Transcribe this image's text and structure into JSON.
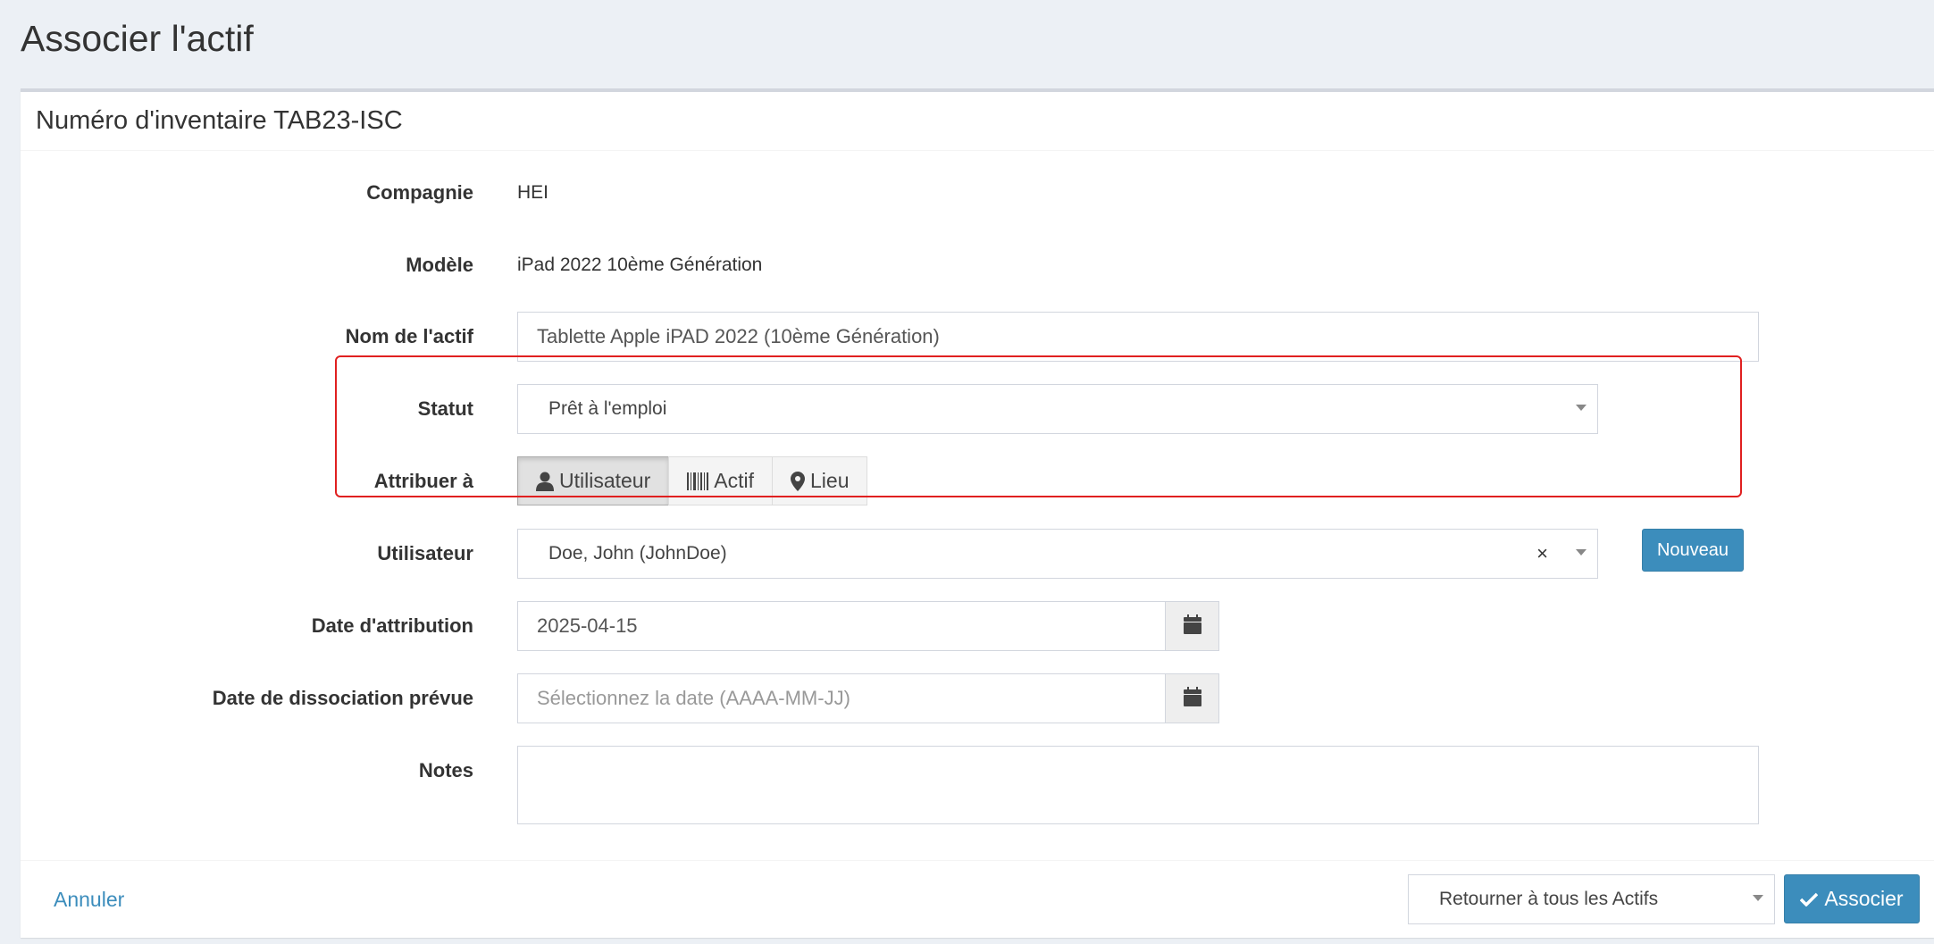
{
  "page": {
    "title": "Associer l'actif"
  },
  "box": {
    "title": "Numéro d'inventaire TAB23-ISC"
  },
  "fields": {
    "company": {
      "label": "Compagnie",
      "value": "HEI"
    },
    "model": {
      "label": "Modèle",
      "value": "iPad 2022 10ème Génération"
    },
    "asset_name": {
      "label": "Nom de l'actif",
      "value": "Tablette Apple iPAD 2022 (10ème Génération)"
    },
    "status": {
      "label": "Statut",
      "value": "Prêt à l'emploi"
    },
    "assign_to": {
      "label": "Attribuer à",
      "options": [
        {
          "label": "Utilisateur",
          "icon": "user-icon",
          "active": true
        },
        {
          "label": "Actif",
          "icon": "barcode-icon",
          "active": false
        },
        {
          "label": "Lieu",
          "icon": "map-marker-icon",
          "active": false
        }
      ]
    },
    "user": {
      "label": "Utilisateur",
      "value": "Doe, John (JohnDoe)",
      "clear": "×",
      "new_button": "Nouveau"
    },
    "checkout_date": {
      "label": "Date d'attribution",
      "value": "2025-04-15"
    },
    "expected_checkin": {
      "label": "Date de dissociation prévue",
      "placeholder": "Sélectionnez la date (AAAA-MM-JJ)"
    },
    "notes": {
      "label": "Notes",
      "value": ""
    }
  },
  "footer": {
    "cancel": "Annuler",
    "redirect": "Retourner à tous les Actifs",
    "submit": "Associer"
  },
  "colors": {
    "primary": "#3c8dbc",
    "highlight": "#e02020",
    "background": "#ecf0f5"
  }
}
